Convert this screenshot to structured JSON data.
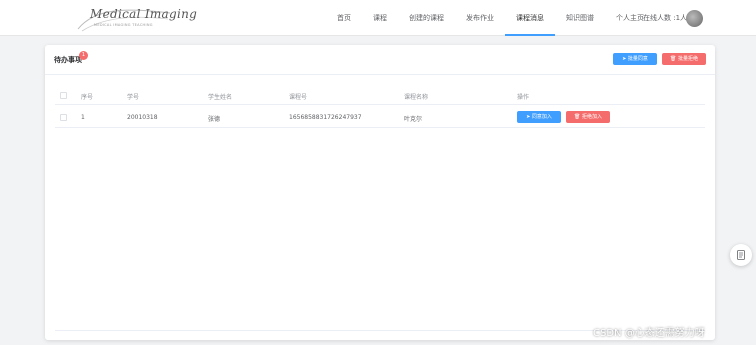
{
  "header": {
    "logo_text": "Medical Imaging",
    "logo_sub": "MEDICAL IMAGING TEACHING",
    "nav": [
      {
        "label": "首页"
      },
      {
        "label": "课程"
      },
      {
        "label": "创建的课程"
      },
      {
        "label": "发布作业"
      },
      {
        "label": "课程消息",
        "active": true
      },
      {
        "label": "知识图谱"
      },
      {
        "label": "个人主页"
      }
    ],
    "online_label": "在线人数 :1人",
    "avatar_icon": "avatar-icon"
  },
  "todo": {
    "title": "待办事项",
    "badge_count": "1",
    "approve_all_label": "批量同意",
    "reject_all_label": "批量拒绝",
    "columns": {
      "index": "序号",
      "student_id": "学号",
      "student_name": "学生姓名",
      "course_id": "课程号",
      "course_name": "课程名称",
      "actions": "操作"
    },
    "rows": [
      {
        "index": "1",
        "student_id": "20010318",
        "student_name": "张德",
        "course_id": "1656858831726247937",
        "course_name": "叶克尔",
        "approve_label": "同意加入",
        "reject_label": "拒绝加入"
      }
    ]
  },
  "watermark": "CSDN @心态还需努力呀",
  "colors": {
    "primary": "#409eff",
    "danger": "#f56c6c",
    "background": "#f2f3f5"
  }
}
